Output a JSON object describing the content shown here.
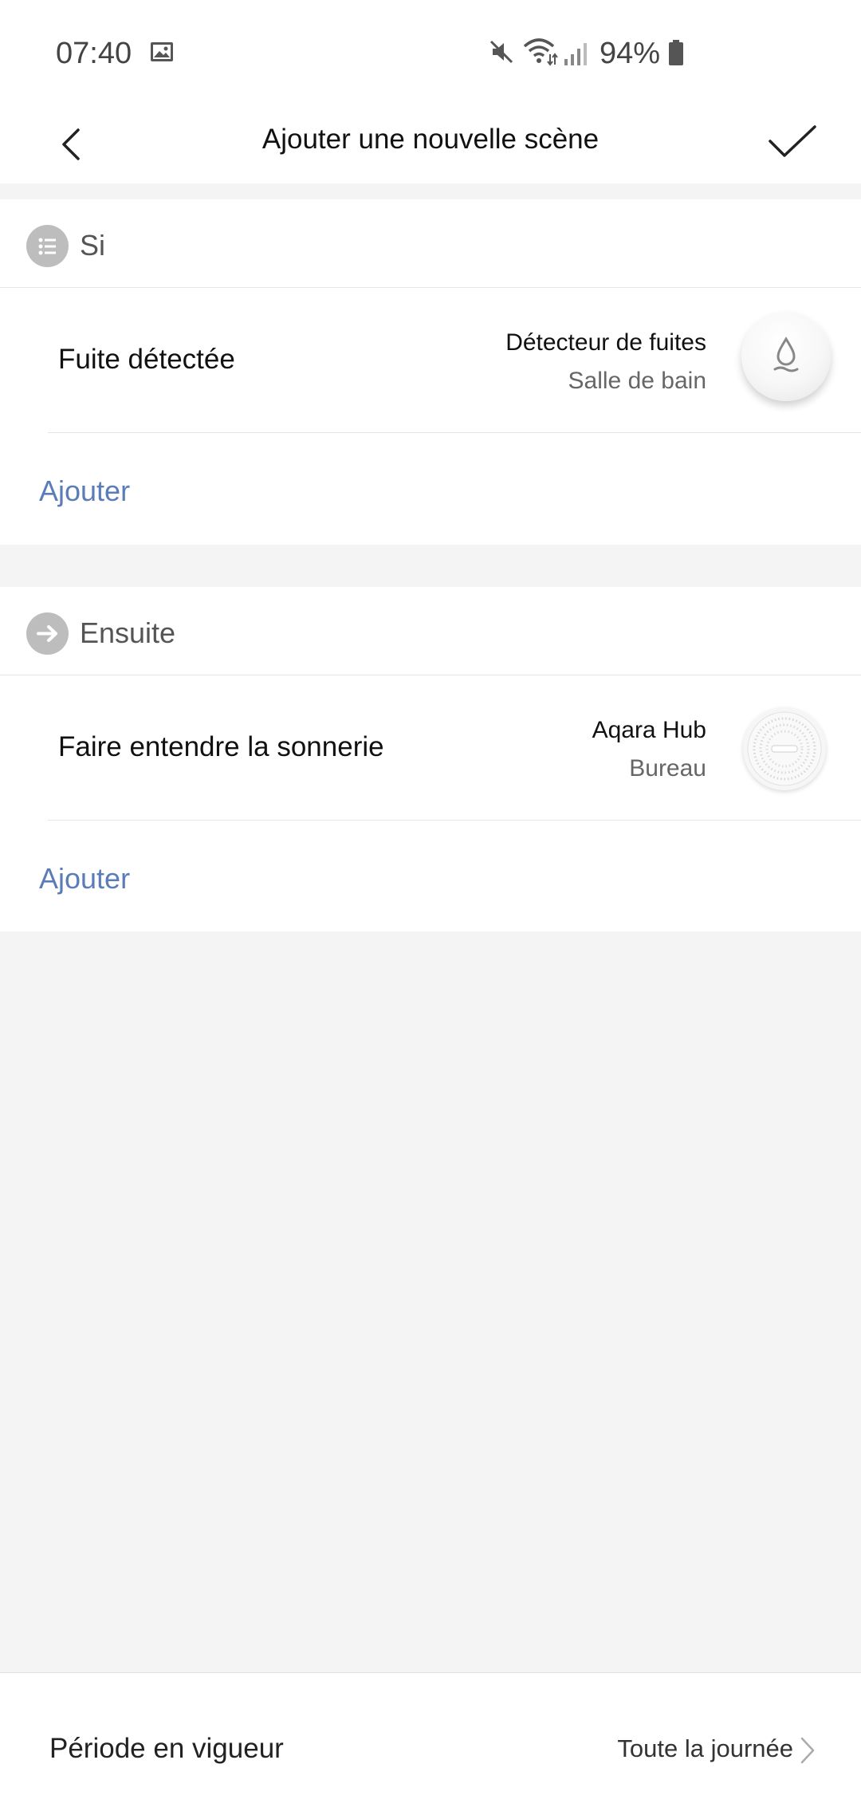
{
  "status_bar": {
    "time": "07:40",
    "battery": "94%",
    "icons": [
      "image-icon",
      "mute-icon",
      "wifi-icon",
      "signal-icon",
      "battery-icon"
    ]
  },
  "header": {
    "title": "Ajouter une nouvelle scène"
  },
  "condition_section": {
    "label": "Si",
    "icon": "list-icon",
    "items": [
      {
        "label": "Fuite détectée",
        "device": "Détecteur de fuites",
        "room": "Salle de bain",
        "icon": "water-leak-sensor-icon"
      }
    ],
    "add_label": "Ajouter"
  },
  "action_section": {
    "label": "Ensuite",
    "icon": "arrow-right-icon",
    "items": [
      {
        "label": "Faire entendre la sonnerie",
        "device": "Aqara Hub",
        "room": "Bureau",
        "icon": "hub-icon"
      }
    ],
    "add_label": "Ajouter"
  },
  "bottom": {
    "label": "Période en vigueur",
    "value": "Toute la journée"
  },
  "colors": {
    "accent": "#5a7cb8",
    "background": "#f4f4f4",
    "section_icon": "#bdbdbd"
  }
}
